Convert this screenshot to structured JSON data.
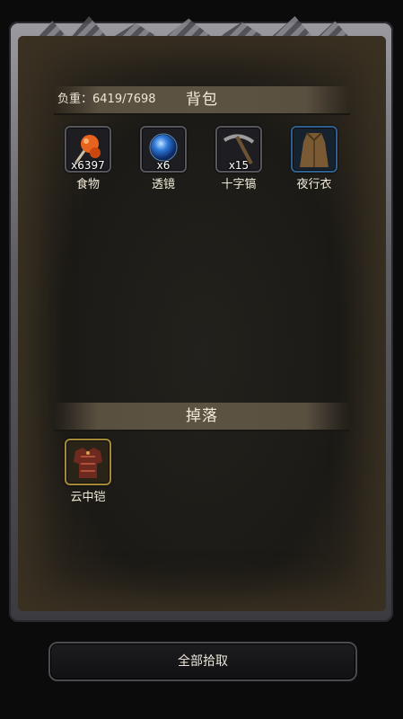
{
  "backpack": {
    "weight_label": "负重：6419/7698",
    "title": "背包",
    "items": [
      {
        "name": "食物",
        "count": "x6397",
        "icon": "food-icon"
      },
      {
        "name": "透镜",
        "count": "x6",
        "icon": "lens-orb-icon"
      },
      {
        "name": "十字镐",
        "count": "x15",
        "icon": "pickaxe-icon"
      },
      {
        "name": "夜行衣",
        "count": "",
        "icon": "night-cloak-icon"
      }
    ]
  },
  "drops": {
    "title": "掉落",
    "items": [
      {
        "name": "云中铠",
        "count": "",
        "icon": "armor-icon"
      }
    ]
  },
  "actions": {
    "pickup_all_label": "全部拾取"
  },
  "colors": {
    "panel_bg": "#1c1a16",
    "bar_bg": "#5a5040",
    "lens_blue": "#2f78d8",
    "rare_gold": "#a48a36"
  }
}
